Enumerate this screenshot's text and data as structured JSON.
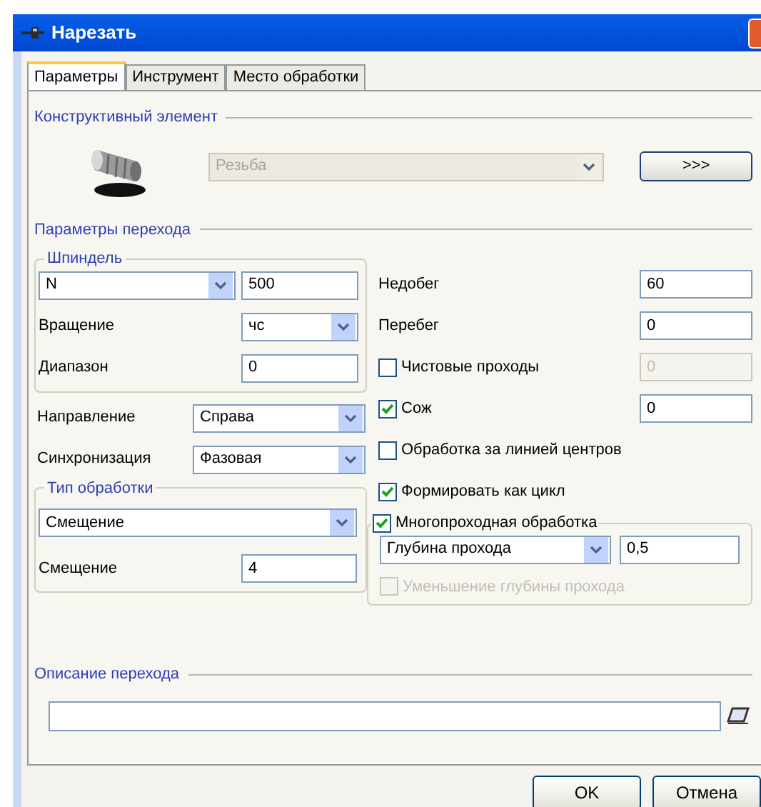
{
  "window": {
    "title": "Нарезать"
  },
  "tabs": [
    {
      "label": "Параметры",
      "selected": true
    },
    {
      "label": "Инструмент",
      "selected": false
    },
    {
      "label": "Место обработки",
      "selected": false
    }
  ],
  "element_section": {
    "legend": "Конструктивный элемент",
    "combo": {
      "value": "Резьба",
      "disabled": true
    },
    "button": ">>>"
  },
  "transition_section": {
    "legend": "Параметры перехода",
    "spindle": {
      "legend": "Шпиндель",
      "mode": "N",
      "speed": "500",
      "rotation": {
        "label": "Вращение",
        "value": "чс"
      },
      "range": {
        "label": "Диапазон",
        "value": "0"
      }
    },
    "direction": {
      "label": "Направление",
      "value": "Справа"
    },
    "sync": {
      "label": "Синхронизация",
      "value": "Фазовая"
    },
    "processing_type": {
      "legend": "Тип обработки",
      "combo": "Смещение",
      "offset": {
        "label": "Смещение",
        "value": "4"
      }
    },
    "underrun": {
      "label": "Недобег",
      "value": "60"
    },
    "overrun": {
      "label": "Перебег",
      "value": "0"
    },
    "options": [
      {
        "kind": "checkbox_field",
        "label": "Чистовые проходы",
        "checked": false,
        "value": "0",
        "disabled": true
      },
      {
        "kind": "checkbox_field",
        "label": "Сож",
        "checked": true,
        "value": "0",
        "disabled": false
      },
      {
        "kind": "checkbox",
        "label": "Обработка за линией центров",
        "checked": false
      },
      {
        "kind": "checkbox",
        "label": "Формировать как цикл",
        "checked": true
      }
    ],
    "multipass": {
      "label": "Многопроходная обработка",
      "checked": true,
      "combo": "Глубина прохода",
      "value": "0,5",
      "reduce": {
        "label": "Уменьшение глубины прохода",
        "checked": false,
        "disabled": true
      }
    }
  },
  "description_section": {
    "legend": "Описание перехода"
  },
  "buttons": [
    "OK",
    "Отмена"
  ]
}
